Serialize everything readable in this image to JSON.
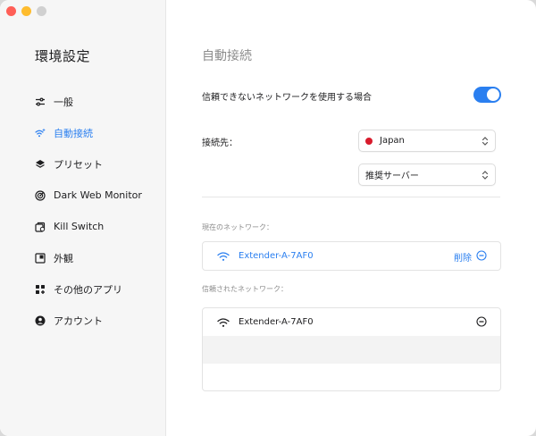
{
  "sidebar": {
    "title": "環境設定",
    "items": [
      {
        "label": "一般",
        "icon": "sliders-icon"
      },
      {
        "label": "自動接続",
        "icon": "wifi-auto-icon"
      },
      {
        "label": "プリセット",
        "icon": "layers-icon"
      },
      {
        "label": "Dark Web Monitor",
        "icon": "radar-icon"
      },
      {
        "label": "Kill Switch",
        "icon": "kill-switch-icon"
      },
      {
        "label": "外観",
        "icon": "appearance-icon"
      },
      {
        "label": "その他のアプリ",
        "icon": "apps-grid-icon"
      },
      {
        "label": "アカウント",
        "icon": "account-icon"
      }
    ],
    "active_index": 1
  },
  "main": {
    "title": "自動接続",
    "untrusted_label": "信頼できないネットワークを使用する場合",
    "untrusted_enabled": true,
    "connect_to_label": "接続先：",
    "country_select": "Japan",
    "server_select": "推奨サーバー",
    "current_network_label": "現在のネットワーク：",
    "current_network": {
      "name": "Extender-A-7AF0",
      "action": "削除"
    },
    "trusted_networks_label": "信頼されたネットワーク：",
    "trusted_networks": [
      {
        "name": "Extender-A-7AF0"
      }
    ]
  },
  "colors": {
    "accent": "#2a7ff0",
    "flag_red": "#d81b2c"
  }
}
